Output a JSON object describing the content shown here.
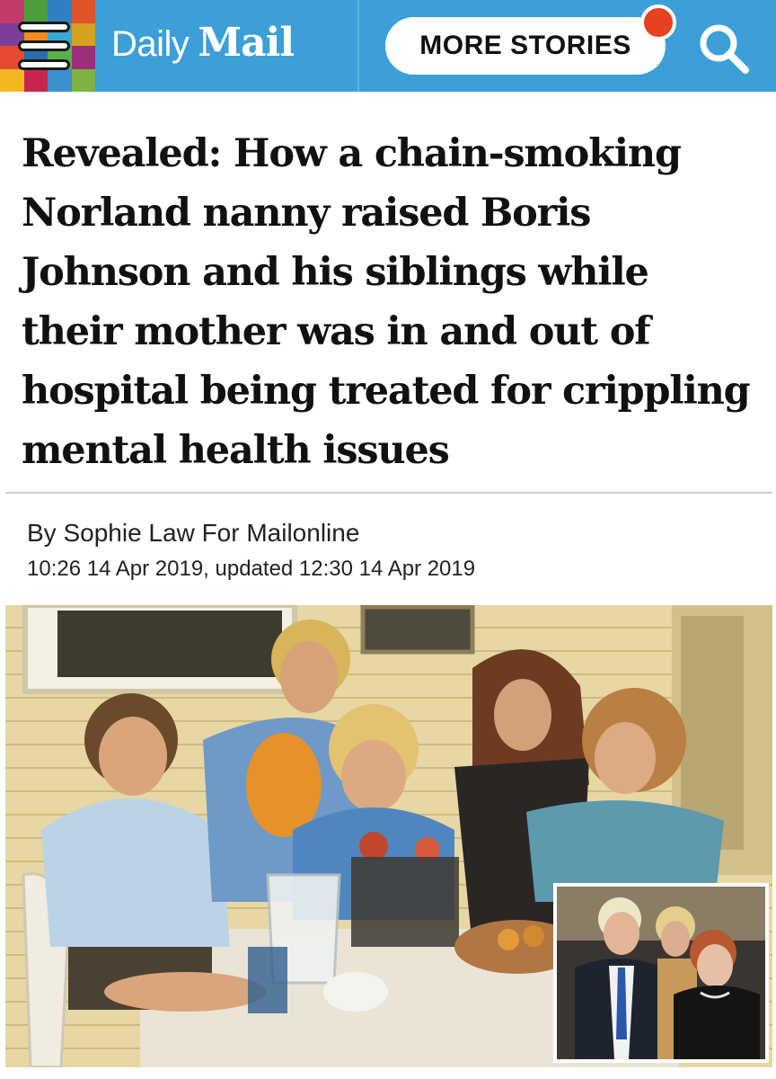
{
  "header": {
    "logo_daily": "Daily",
    "logo_mail": "Mail",
    "more_stories_label": "MORE STORIES",
    "mosaic_colors": [
      "#c23b6b",
      "#4f9e3c",
      "#2f7fc2",
      "#e0532b",
      "#7b3f98",
      "#f28c1e",
      "#3aa7d9",
      "#d4a21c",
      "#e64a31",
      "#2b6cb0",
      "#56b24a",
      "#9b2f7a",
      "#f2b722",
      "#c7254e",
      "#3d8fd1",
      "#7cb342"
    ]
  },
  "article": {
    "headline": "Revealed: How a chain-smoking Norland nanny raised Boris Johnson and his siblings while their mother was in and out of hospital being treated for crippling mental health issues",
    "byline": "By Sophie Law For Mailonline",
    "timestamp": "10:26 14 Apr 2019, updated 12:30 14 Apr 2019"
  },
  "colors": {
    "brand_blue": "#3c9fd8",
    "notification_red": "#e8411f"
  },
  "icons": {
    "menu": "hamburger-menu-icon",
    "search": "search-icon"
  }
}
